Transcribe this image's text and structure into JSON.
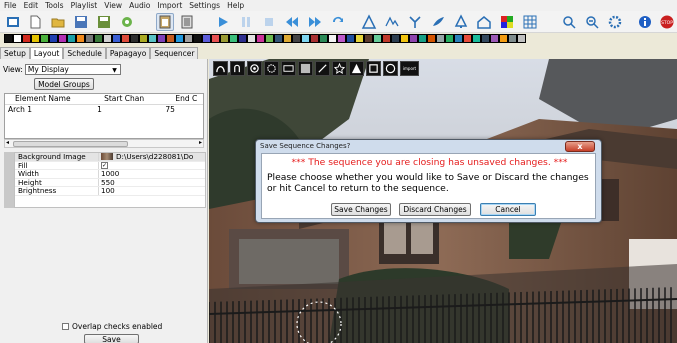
{
  "menu": [
    "File",
    "Edit",
    "Tools",
    "Playlist",
    "View",
    "Audio",
    "Import",
    "Settings",
    "Help"
  ],
  "toolbar_icons": [
    "new-sequence-icon",
    "new-file-icon",
    "open-folder-icon",
    "save-icon",
    "save-as-icon",
    "settings-wrench-icon",
    "clipboard-icon",
    "paste-icon",
    "play-icon",
    "pause-icon",
    "stop-icon",
    "rewind-icon",
    "fast-forward-icon",
    "repeat-icon",
    "warning-triangle-icon",
    "effects-icon",
    "fan-icon",
    "brush-icon",
    "tree-icon",
    "house-icon",
    "color-icon",
    "grid-icon",
    "zoom-in-icon",
    "zoom-out-icon",
    "gear-icon",
    "info-icon",
    "stop-sign-icon"
  ],
  "palette_colors": [
    "#111111",
    "#ffffff",
    "#d22a1e",
    "#e3c300",
    "#4bb23b",
    "#1f3fb0",
    "#b12fb3",
    "#1aa0a6",
    "#f08a1c",
    "#777777",
    "#3a7a3a",
    "#d0d0d0",
    "#3b5fd3",
    "#dd4b39",
    "#2d2d2d",
    "#aaaa22",
    "#58c2c6",
    "#7c3eb8",
    "#c45c1f",
    "#2299dd",
    "#a0a0a0",
    "#111111",
    "#5d5dd9",
    "#e65151",
    "#9b9b33",
    "#3bbf7b",
    "#2f2f8f",
    "#e2e2e2",
    "#cc3399",
    "#6cb94f",
    "#335577",
    "#ddaa33",
    "#444444",
    "#7fd6f0",
    "#a93131",
    "#2b8a57",
    "#f4f4f4",
    "#bc58c9",
    "#1e4f9e",
    "#e5d53b",
    "#5b3b2b",
    "#66cc99",
    "#c0392b",
    "#2c3e50",
    "#f1c40f",
    "#8e44ad",
    "#16a085",
    "#d35400",
    "#95a5a6",
    "#27ae60",
    "#2980b9",
    "#e74c3c",
    "#1abc9c",
    "#34495e",
    "#9b59b6",
    "#f39c12",
    "#7f8c8d",
    "#c0c0c0"
  ],
  "tabs": [
    "Setup",
    "Layout",
    "Schedule",
    "Papagayo",
    "Sequencer"
  ],
  "active_tab": "Layout",
  "view": {
    "label": "View:",
    "selected": "My Display"
  },
  "model_groups_label": "Model Groups",
  "grid": {
    "headers": [
      "Element Name",
      "Start Chan",
      "End C"
    ],
    "rows": [
      [
        "Arch 1",
        "1",
        "75"
      ]
    ]
  },
  "properties": [
    {
      "name": "Background Image",
      "value": "D:\\Users\\d228081\\Do",
      "kind": "image"
    },
    {
      "name": "Fill",
      "value": "✓",
      "kind": "check"
    },
    {
      "name": "Width",
      "value": "1000",
      "kind": "text"
    },
    {
      "name": "Height",
      "value": "550",
      "kind": "text"
    },
    {
      "name": "Brightness",
      "value": "100",
      "kind": "text"
    }
  ],
  "overlap_label": "Overlap checks enabled",
  "save_label": "Save",
  "draw_tools": [
    "arch-tool-icon",
    "candy-cane-tool-icon",
    "circle-tool-icon",
    "wreath-tool-icon",
    "matrix-tool-icon",
    "grid-tool-icon",
    "line-tool-icon",
    "star-tool-icon",
    "tree-tool-icon",
    "square-tool-icon",
    "ring-tool-icon",
    "import-tool-icon"
  ],
  "import_label": "import",
  "dialog": {
    "title": "Save Sequence Changes?",
    "close": "x",
    "warning": "*** The sequence you are closing has unsaved changes. ***",
    "message": "Please choose whether you would like to Save or Discard the changes or hit Cancel to return to the sequence.",
    "save_changes": "Save Changes",
    "discard_changes": "Discard Changes",
    "cancel": "Cancel"
  }
}
